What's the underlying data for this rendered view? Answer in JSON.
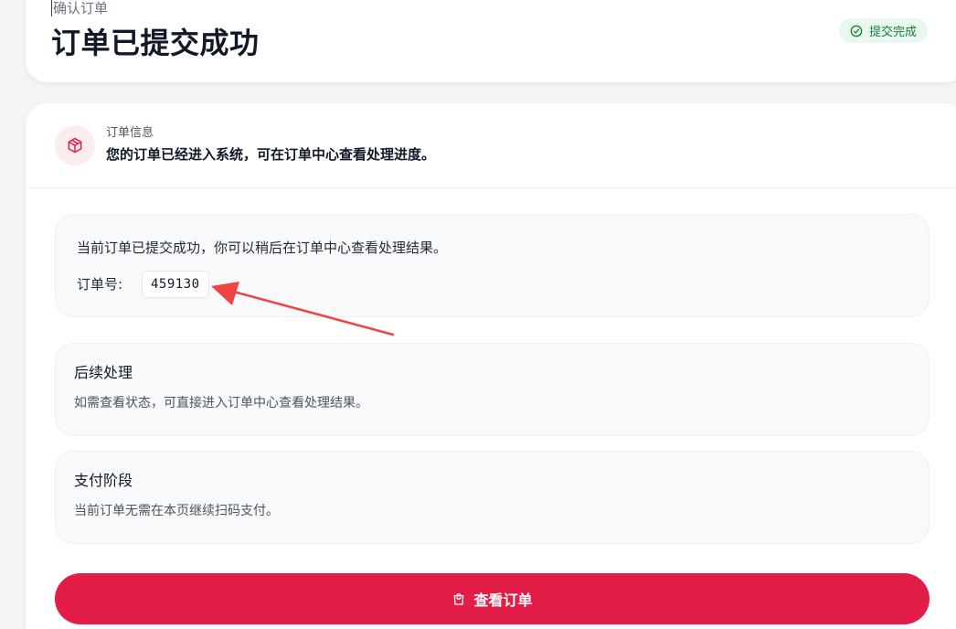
{
  "header": {
    "breadcrumb": "确认订单",
    "title": "订单已提交成功",
    "status_badge": "提交完成",
    "status_icon": "check-circle-icon",
    "status_color": "#15803d"
  },
  "info": {
    "icon": "package-icon",
    "label": "订单信息",
    "description": "您的订单已经进入系统，可在订单中心查看处理进度。"
  },
  "order": {
    "message": "当前订单已提交成功，你可以稍后在订单中心查看处理结果。",
    "number_label": "订单号:",
    "number_value": "459130"
  },
  "follow_up": {
    "title": "后续处理",
    "text": "如需查看状态，可直接进入订单中心查看处理结果。"
  },
  "payment": {
    "title": "支付阶段",
    "text": "当前订单无需在本页继续扫码支付。"
  },
  "action": {
    "button_label": "查看订单",
    "button_icon": "shopping-bag-icon",
    "button_color": "#e11d48"
  },
  "annotation": {
    "arrow_color": "#ef4444"
  }
}
